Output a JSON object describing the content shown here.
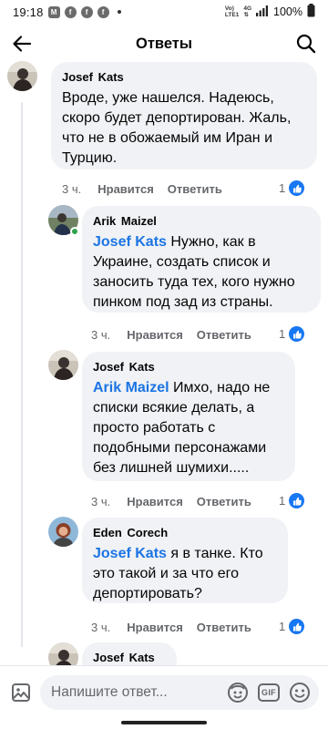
{
  "status_bar": {
    "time": "19:18",
    "notification_icons": [
      "m-app-icon",
      "facebook-icon",
      "facebook-icon",
      "facebook-icon"
    ],
    "network_label_top": "Vo)",
    "network_label_bottom": "LTE1",
    "network_type": "4G",
    "battery": "100%"
  },
  "header": {
    "title": "Ответы"
  },
  "comments": [
    {
      "author": "Josef  Kats",
      "mention": "",
      "text": "Вроде, уже нашелся. Надеюсь, скоро будет депортирован. Жаль, что не в обожаемый им Иран и Турцию.",
      "time": "3 ч.",
      "like_label": "Нравится",
      "reply_label": "Ответить",
      "likes": "1",
      "online": false
    },
    {
      "author": "Arik Maizel",
      "mention": "Josef  Kats",
      "text": " Нужно, как в Украине, создать список и заносить туда тех, кого нужно пинком под зад из страны.",
      "time": "3 ч.",
      "like_label": "Нравится",
      "reply_label": "Ответить",
      "likes": "1",
      "online": true
    },
    {
      "author": "Josef  Kats",
      "mention": "Arik Maizel",
      "text": " Имхо, надо не списки всякие делать, а просто работать с подобными персонажами без лишней шумихи.....",
      "time": "3 ч.",
      "like_label": "Нравится",
      "reply_label": "Ответить",
      "likes": "1",
      "online": false
    },
    {
      "author": "Eden Corech",
      "mention": "Josef  Kats",
      "text": " я в танке. Кто это такой и за что его депортировать?",
      "time": "3 ч.",
      "like_label": "Нравится",
      "reply_label": "Ответить",
      "likes": "1",
      "online": false
    },
    {
      "author": "Josef  Kats",
      "mention": "",
      "text": "",
      "time": "",
      "like_label": "",
      "reply_label": "",
      "likes": "",
      "online": false
    }
  ],
  "composer": {
    "placeholder": "Напишите ответ...",
    "gif_label": "GIF"
  },
  "colors": {
    "accent": "#1877f2",
    "mention": "#1b74e4",
    "bubble": "#f0f2f5",
    "secondary_text": "#65676b",
    "online": "#31a24c"
  }
}
